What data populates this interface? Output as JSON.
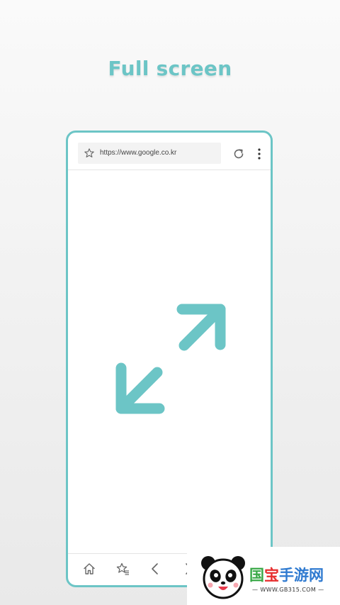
{
  "headline": "Full screen",
  "browser": {
    "url": "https://www.google.co.kr",
    "icons": {
      "bookmark": "star-icon",
      "reload": "reload-icon",
      "menu": "more-vertical-icon"
    }
  },
  "feature_icon": "fullscreen-expand-icon",
  "bottom_nav": [
    "home-icon",
    "bookmarks-icon",
    "back-icon",
    "forward-icon"
  ],
  "colors": {
    "accent": "#6cc5c6",
    "background": "#f2f2f2"
  },
  "watermark": {
    "parts": [
      "国",
      "宝",
      "手游网"
    ],
    "url": "— WWW.GB315.COM —"
  }
}
